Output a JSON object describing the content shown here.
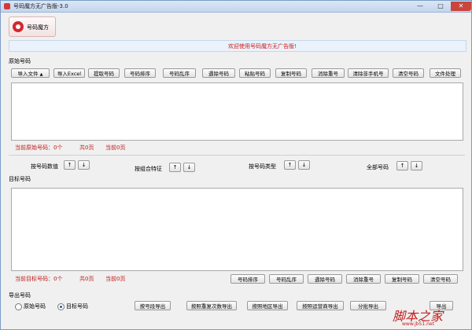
{
  "window": {
    "title": "号码魔方无广告版-3.0",
    "min": "—",
    "max": "□",
    "close": "✕"
  },
  "brand": {
    "name": "号码魔方"
  },
  "welcome": "欢迎使用号码魔方无广告版!",
  "source": {
    "label": "原始号码",
    "buttons": [
      "导入文件",
      "导入Excel",
      "提取号码",
      "号码排序",
      "号码乱序",
      "遇除号码",
      "粘贴号码",
      "复制号码",
      "消除重号",
      "清除非手机号",
      "清空号码",
      "文件处理"
    ],
    "import_arrow": "▲",
    "stats": {
      "count": "当前原始号码：0个",
      "pages": "共0页",
      "current": "当前0页"
    }
  },
  "sort": {
    "by_segment": "按号码数值",
    "by_combo": "按组合特征",
    "by_type": "按号码类型",
    "all": "全部号码",
    "up": "↑",
    "down": "↓"
  },
  "target": {
    "label": "目标号码",
    "stats": {
      "count": "当前目标号码：0个",
      "pages": "共0页",
      "current": "当前0页"
    },
    "buttons": [
      "号码排序",
      "号码乱序",
      "遇除号码",
      "消除重号",
      "复制号码",
      "清空号码"
    ]
  },
  "export": {
    "label": "导出号码",
    "options": [
      "原始号码",
      "目标号码"
    ],
    "selected": "目标号码",
    "buttons": [
      "按号段导出",
      "按照重复次数导出",
      "按照地区导出",
      "按照运营商导出",
      "分批导出",
      "导出"
    ]
  },
  "watermark": {
    "text": "脚本之家",
    "sub": "www.jb51.net"
  }
}
